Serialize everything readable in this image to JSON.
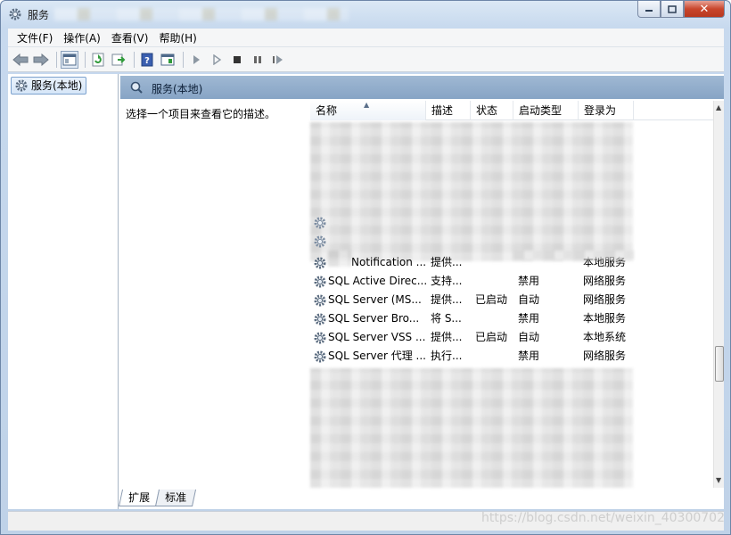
{
  "window": {
    "title": "服务"
  },
  "menu": [
    "文件(F)",
    "操作(A)",
    "查看(V)",
    "帮助(H)"
  ],
  "toolbar": [
    "back-arrow-icon",
    "forward-arrow-icon",
    "console-tree-icon",
    "refresh-icon",
    "export-list-icon",
    "help-icon",
    "properties-icon",
    "play-icon",
    "play-alt-icon",
    "stop-icon",
    "pause-icon",
    "resume-icon"
  ],
  "tree": {
    "root": "服务(本地)"
  },
  "pane": {
    "header": "服务(本地)",
    "description": "选择一个项目来查看它的描述。"
  },
  "columns": [
    "名称",
    "描述",
    "状态",
    "启动类型",
    "登录为"
  ],
  "rows": [
    {
      "name": "Notification ...",
      "desc": "提供...",
      "state": "",
      "start": "",
      "logon": "本地服务"
    },
    {
      "name": "SQL Active Direc...",
      "desc": "支持...",
      "state": "",
      "start": "禁用",
      "logon": "网络服务"
    },
    {
      "name": "SQL Server (MS...",
      "desc": "提供...",
      "state": "已启动",
      "start": "自动",
      "logon": "网络服务"
    },
    {
      "name": "SQL Server Bro...",
      "desc": "将 S...",
      "state": "",
      "start": "禁用",
      "logon": "本地服务"
    },
    {
      "name": "SQL Server VSS ...",
      "desc": "提供...",
      "state": "已启动",
      "start": "自动",
      "logon": "本地系统"
    },
    {
      "name": "SQL Server 代理 ...",
      "desc": "执行...",
      "state": "",
      "start": "禁用",
      "logon": "网络服务"
    }
  ],
  "tabs": [
    "扩展",
    "标准"
  ],
  "watermark": "https://blog.csdn.net/weixin_40300702",
  "colors": {
    "header": "#9fb8d3",
    "titlebar": "#c7d9ee",
    "close": "#c9462c"
  }
}
